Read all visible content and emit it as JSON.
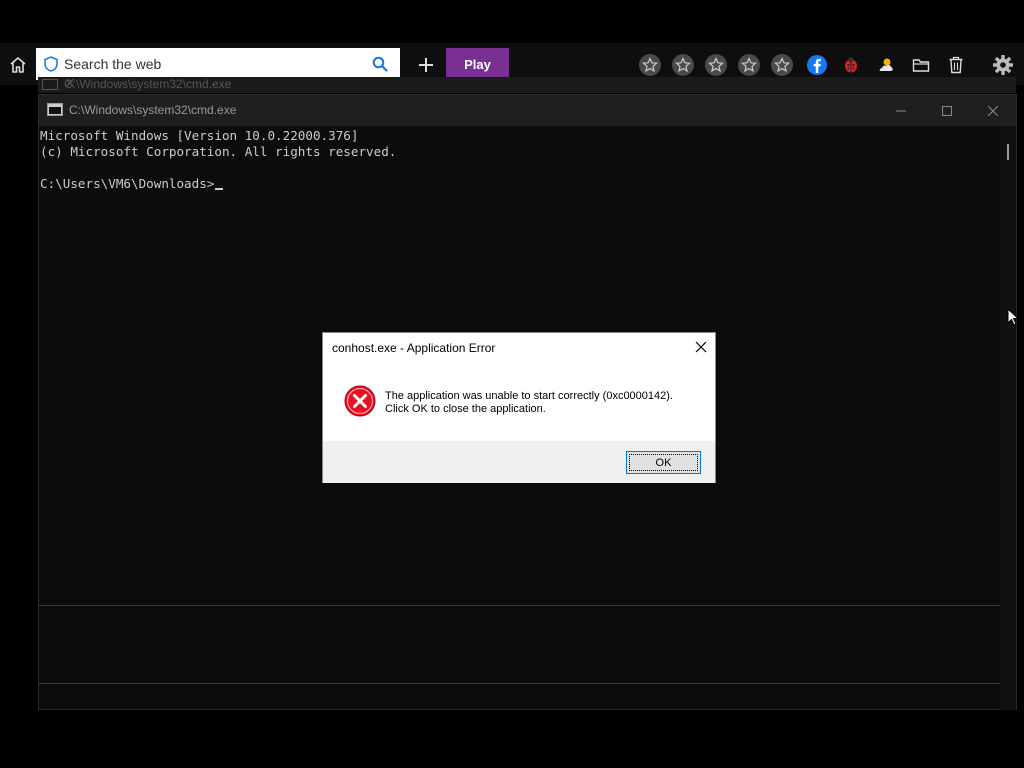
{
  "toolbar": {
    "search_placeholder": "Search the web",
    "play_label": "Play",
    "star_count": 5,
    "icons": [
      "home-icon",
      "shield-icon",
      "search-icon",
      "plus-icon",
      "star-icon",
      "facebook-icon",
      "ladybug-icon",
      "weather-icon",
      "folder-icon",
      "trash-icon",
      "gear-icon"
    ],
    "colors": {
      "play": "#7a2f92",
      "facebook": "#1877f2",
      "ladybug": "#d9232c"
    }
  },
  "ghost_window": {
    "title": "C:\\Windows\\system32\\cmd.exe"
  },
  "cmd_window": {
    "title": "C:\\Windows\\system32\\cmd.exe",
    "lines": [
      "Microsoft Windows [Version 10.0.22000.376]",
      "(c) Microsoft Corporation. All rights reserved.",
      "",
      "C:\\Users\\VM6\\Downloads>"
    ]
  },
  "dialog": {
    "title": "conhost.exe - Application Error",
    "message_line1": "The application was unable to start correctly (0xc0000142).",
    "message_line2": "Click OK to close the application.",
    "ok_label": "OK",
    "icon": "error-icon",
    "error_color": "#e81123"
  }
}
